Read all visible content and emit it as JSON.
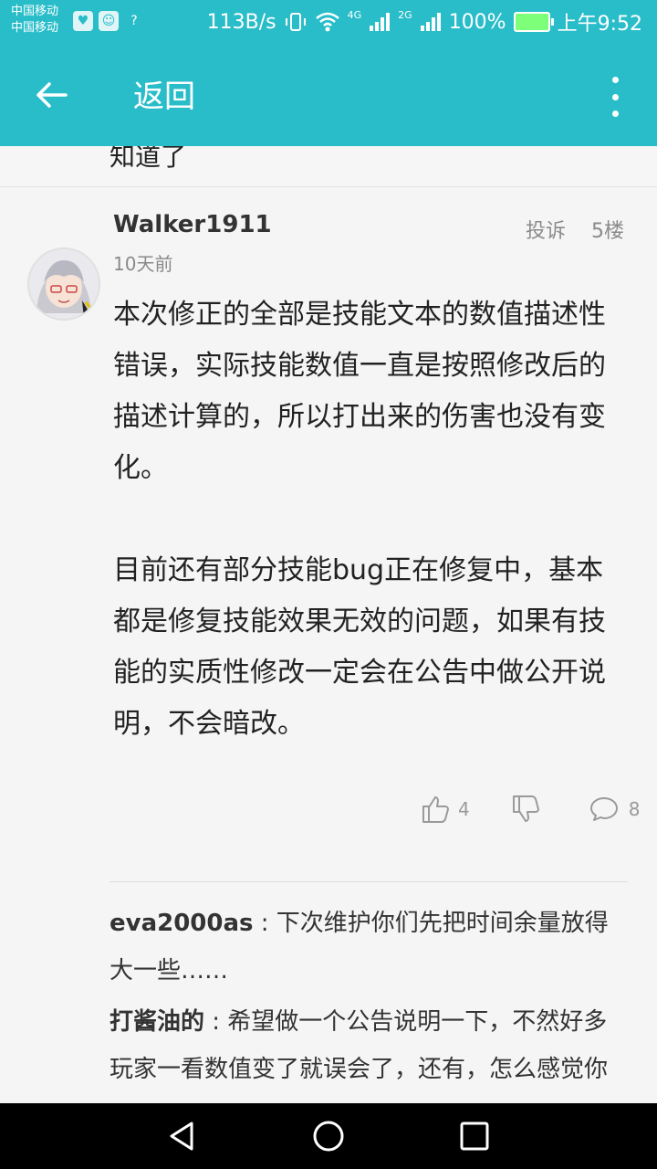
{
  "status_bar": {
    "carrier_1": "中国移动",
    "carrier_2": "中国移动",
    "speed": "113B/s",
    "net_4g": "4G",
    "net_2g": "2G",
    "battery": "100%",
    "time": "上午9:52",
    "icons": [
      "heartbeat-icon",
      "app-icon",
      "wifi-question-icon",
      "vibrate-icon",
      "wifi-icon",
      "signal-icon",
      "battery-icon"
    ]
  },
  "app_bar": {
    "title": "返回",
    "back_icon": "arrow-left-icon",
    "more_icon": "more-vertical-icon",
    "color": "#29bdc9"
  },
  "previous_text": "知道了",
  "post": {
    "username": "Walker1911",
    "time": "10天前",
    "report_label": "投诉",
    "floor": "5楼",
    "paragraph_1": "本次修正的全部是技能文本的数值描述性错误，实际技能数值一直是按照修改后的描述计算的，所以打出来的伤害也没有变化。",
    "paragraph_2": "目前还有部分技能bug正在修复中，基本都是修复技能效果无效的问题，如果有技能的实质性修改一定会在公告中做公开说明，不会暗改。",
    "likes": "4",
    "comments": "8"
  },
  "replies": [
    {
      "name": "eva2000as",
      "text": " : 下次维护你们先把时间余量放得大一些……"
    },
    {
      "name": "打酱油的",
      "text": " : 希望做一个公告说明一下，不然好多玩家一看数值变了就误会了，还有，怎么感觉你们跟玩家互动就这么差呢？可以在taptap"
    }
  ],
  "nav_bar": {
    "back_icon": "triangle-back-icon",
    "home_icon": "circle-home-icon",
    "recent_icon": "square-recent-icon"
  }
}
